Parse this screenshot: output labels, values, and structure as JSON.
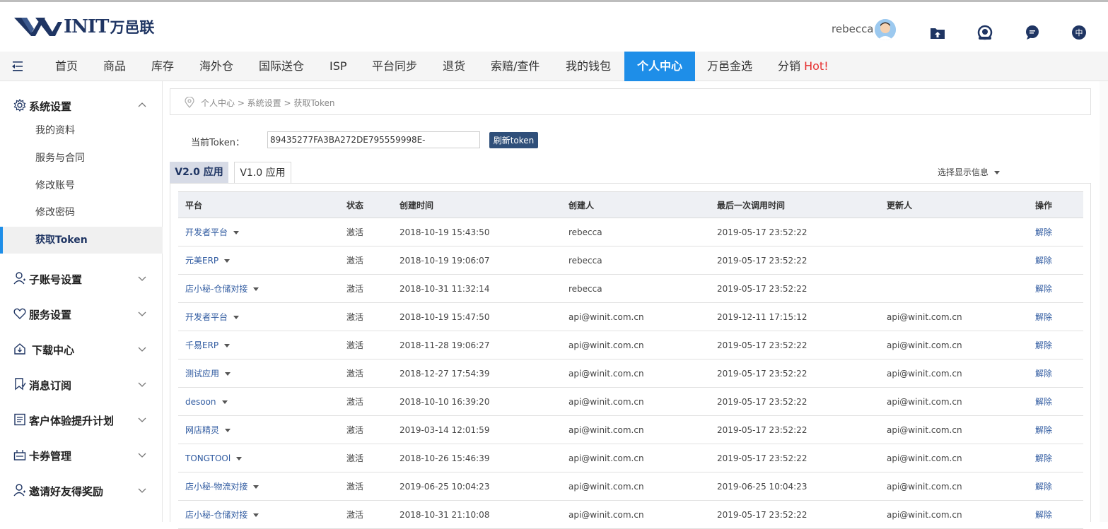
{
  "header": {
    "logo_text": "INIT",
    "logo_cn": "万邑联",
    "username": "rebecca"
  },
  "icons": {
    "upload": "upload-icon",
    "support": "headset-icon",
    "message": "chat-icon",
    "language": "language-icon",
    "lang_text": "中"
  },
  "nav": {
    "items": [
      "首页",
      "商品",
      "库存",
      "海外仓",
      "国际送仓",
      "ISP",
      "平台同步",
      "退货",
      "索赔/查件",
      "我的钱包",
      "个人中心",
      "万邑金选",
      "分销"
    ],
    "hot_label": "Hot!",
    "active_index": 10
  },
  "sidebar": {
    "groups": [
      {
        "label": "系统设置",
        "icon": "gear-icon",
        "expanded": true
      },
      {
        "label": "子账号设置",
        "icon": "user-icon"
      },
      {
        "label": "服务设置",
        "icon": "heart-icon"
      },
      {
        "label": "下载中心",
        "icon": "download-icon"
      },
      {
        "label": "消息订阅",
        "icon": "bookmark-icon"
      },
      {
        "label": "客户体验提升计划",
        "icon": "list-icon"
      },
      {
        "label": "卡券管理",
        "icon": "ticket-icon"
      },
      {
        "label": "邀请好友得奖励",
        "icon": "user-plus-icon"
      }
    ],
    "sub_items": [
      "我的资料",
      "服务与合同",
      "修改账号",
      "修改密码",
      "获取Token"
    ],
    "active_sub": 4
  },
  "breadcrumb": "个人中心 > 系统设置 > 获取Token",
  "token": {
    "label": "当前Token：",
    "value": "89435277FA3BA272DE795559998E-",
    "refresh_label": "刷新token"
  },
  "tabs": [
    "V2.0 应用",
    "V1.0 应用"
  ],
  "show_info_label": "选择显示信息",
  "table": {
    "columns": [
      "平台",
      "状态",
      "创建时间",
      "创建人",
      "最后一次调用时间",
      "更新人",
      "操作"
    ],
    "rows": [
      [
        "开发者平台",
        "激活",
        "2018-10-19 15:43:50",
        "rebecca",
        "2019-05-17 23:52:22",
        "",
        "解除"
      ],
      [
        "元美ERP",
        "激活",
        "2018-10-19 19:06:07",
        "rebecca",
        "2019-05-17 23:52:22",
        "",
        "解除"
      ],
      [
        "店小秘-仓储对接",
        "激活",
        "2018-10-31 11:32:14",
        "rebecca",
        "2019-05-17 23:52:22",
        "",
        "解除"
      ],
      [
        "开发者平台",
        "激活",
        "2018-10-19 15:47:50",
        "api@winit.com.cn",
        "2019-12-11 17:15:12",
        "api@winit.com.cn",
        "解除"
      ],
      [
        "千易ERP",
        "激活",
        "2018-11-28 19:06:27",
        "api@winit.com.cn",
        "2019-05-17 23:52:22",
        "api@winit.com.cn",
        "解除"
      ],
      [
        "测试应用",
        "激活",
        "2018-12-27 17:54:39",
        "api@winit.com.cn",
        "2019-05-17 23:52:22",
        "api@winit.com.cn",
        "解除"
      ],
      [
        "desoon",
        "激活",
        "2018-10-10 16:39:20",
        "api@winit.com.cn",
        "2019-05-17 23:52:22",
        "api@winit.com.cn",
        "解除"
      ],
      [
        "网店精灵",
        "激活",
        "2019-03-14 12:01:59",
        "api@winit.com.cn",
        "2019-05-17 23:52:22",
        "api@winit.com.cn",
        "解除"
      ],
      [
        "TONGTOOl",
        "激活",
        "2018-10-26 15:46:39",
        "api@winit.com.cn",
        "2019-05-17 23:52:22",
        "api@winit.com.cn",
        "解除"
      ],
      [
        "店小秘-物流对接",
        "激活",
        "2019-06-25 10:04:23",
        "api@winit.com.cn",
        "2019-06-25 10:04:23",
        "api@winit.com.cn",
        "解除"
      ],
      [
        "店小秘-仓储对接",
        "激活",
        "2018-10-31 21:10:08",
        "api@winit.com.cn",
        "2019-05-17 23:52:22",
        "api@winit.com.cn",
        "解除"
      ]
    ]
  },
  "colors": {
    "accent": "#1e8ee8",
    "navy": "#1f3563",
    "link": "#2f5aa0",
    "hot": "#e62e2e"
  }
}
